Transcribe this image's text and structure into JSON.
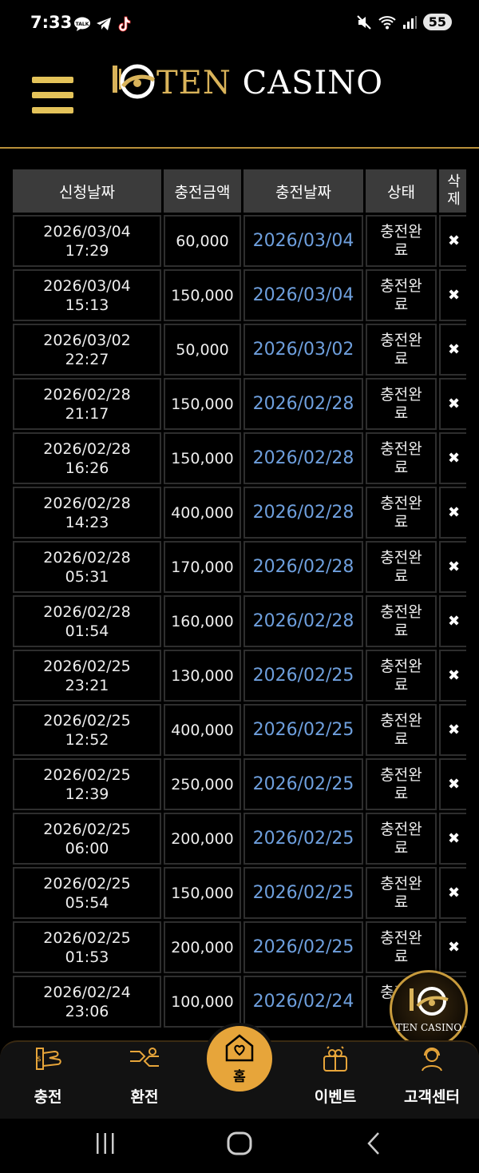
{
  "status_bar": {
    "time": "7:33",
    "battery": "55",
    "icons": [
      "kakaotalk-icon",
      "telegram-icon",
      "tiktok-icon",
      "mute-icon",
      "wifi-icon",
      "signal-icon"
    ]
  },
  "header": {
    "logo_text_1": "TEN",
    "logo_text_2": "CASINO",
    "menu_icon": "hamburger-icon"
  },
  "colors": {
    "gold": "#e4c35a",
    "link_blue": "#6e9fdd",
    "home_button": "#e7a53a",
    "header_bg": "#3b3b3b"
  },
  "table": {
    "headers": [
      "신청날짜",
      "충전금액",
      "충전날짜",
      "상태",
      "삭제"
    ],
    "rows": [
      {
        "req_date": "2026/03/04",
        "req_time": "17:29",
        "amount": "60,000",
        "charge_date": "2026/03/04",
        "status": "충전완료",
        "delete": "✖"
      },
      {
        "req_date": "2026/03/04",
        "req_time": "15:13",
        "amount": "150,000",
        "charge_date": "2026/03/04",
        "status": "충전완료",
        "delete": "✖"
      },
      {
        "req_date": "2026/03/02",
        "req_time": "22:27",
        "amount": "50,000",
        "charge_date": "2026/03/02",
        "status": "충전완료",
        "delete": "✖"
      },
      {
        "req_date": "2026/02/28",
        "req_time": "21:17",
        "amount": "150,000",
        "charge_date": "2026/02/28",
        "status": "충전완료",
        "delete": "✖"
      },
      {
        "req_date": "2026/02/28",
        "req_time": "16:26",
        "amount": "150,000",
        "charge_date": "2026/02/28",
        "status": "충전완료",
        "delete": "✖"
      },
      {
        "req_date": "2026/02/28",
        "req_time": "14:23",
        "amount": "400,000",
        "charge_date": "2026/02/28",
        "status": "충전완료",
        "delete": "✖"
      },
      {
        "req_date": "2026/02/28",
        "req_time": "05:31",
        "amount": "170,000",
        "charge_date": "2026/02/28",
        "status": "충전완료",
        "delete": "✖"
      },
      {
        "req_date": "2026/02/28",
        "req_time": "01:54",
        "amount": "160,000",
        "charge_date": "2026/02/28",
        "status": "충전완료",
        "delete": "✖"
      },
      {
        "req_date": "2026/02/25",
        "req_time": "23:21",
        "amount": "130,000",
        "charge_date": "2026/02/25",
        "status": "충전완료",
        "delete": "✖"
      },
      {
        "req_date": "2026/02/25",
        "req_time": "12:52",
        "amount": "400,000",
        "charge_date": "2026/02/25",
        "status": "충전완료",
        "delete": "✖"
      },
      {
        "req_date": "2026/02/25",
        "req_time": "12:39",
        "amount": "250,000",
        "charge_date": "2026/02/25",
        "status": "충전완료",
        "delete": "✖"
      },
      {
        "req_date": "2026/02/25",
        "req_time": "06:00",
        "amount": "200,000",
        "charge_date": "2026/02/25",
        "status": "충전완료",
        "delete": "✖"
      },
      {
        "req_date": "2026/02/25",
        "req_time": "05:54",
        "amount": "150,000",
        "charge_date": "2026/02/25",
        "status": "충전완료",
        "delete": "✖"
      },
      {
        "req_date": "2026/02/25",
        "req_time": "01:53",
        "amount": "200,000",
        "charge_date": "2026/02/25",
        "status": "충전완료",
        "delete": "✖"
      },
      {
        "req_date": "2026/02/24",
        "req_time": "23:06",
        "amount": "100,000",
        "charge_date": "2026/02/24",
        "status": "충전완료",
        "delete": "✖"
      }
    ]
  },
  "floating_badge": {
    "text": "TEN CASINO"
  },
  "bottom_nav": {
    "items": [
      {
        "label": "충전",
        "icon": "deposit-icon"
      },
      {
        "label": "환전",
        "icon": "exchange-icon"
      },
      {
        "label": "홈",
        "icon": "home-icon"
      },
      {
        "label": "이벤트",
        "icon": "gift-icon"
      },
      {
        "label": "고객센터",
        "icon": "support-icon"
      }
    ]
  },
  "system_nav": {
    "recent_icon": "recent-apps-icon",
    "home_icon": "system-home-icon",
    "back_icon": "back-icon"
  }
}
